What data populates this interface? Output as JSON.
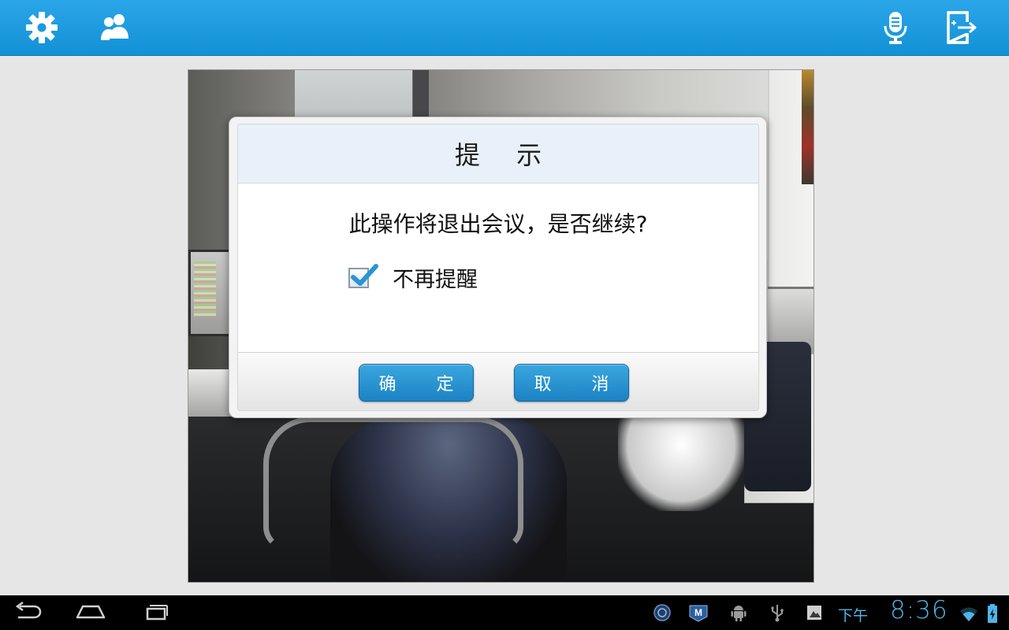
{
  "app_bar": {
    "icons": [
      "gear-icon",
      "participants-icon",
      "microphone-icon",
      "exit-meeting-icon"
    ],
    "accent_color": "#1a9be0"
  },
  "dialog": {
    "title": "提 示",
    "message": "此操作将退出会议，是否继续?",
    "checkbox_label": "不再提醒",
    "checkbox_checked": true,
    "confirm_label": "确 定",
    "cancel_label": "取 消",
    "button_color": "#2a95d2"
  },
  "system_bar": {
    "nav_icons": [
      "back-icon",
      "home-icon",
      "recent-apps-icon"
    ],
    "notification_icons": [
      "app-notification-icon",
      "meeting-app-icon",
      "android-debug-icon",
      "usb-icon",
      "sd-card-icon"
    ],
    "ampm": "下午",
    "time": "8:36",
    "status_icons": [
      "wifi-icon",
      "battery-icon"
    ],
    "clock_color": "#4fb4e8"
  }
}
